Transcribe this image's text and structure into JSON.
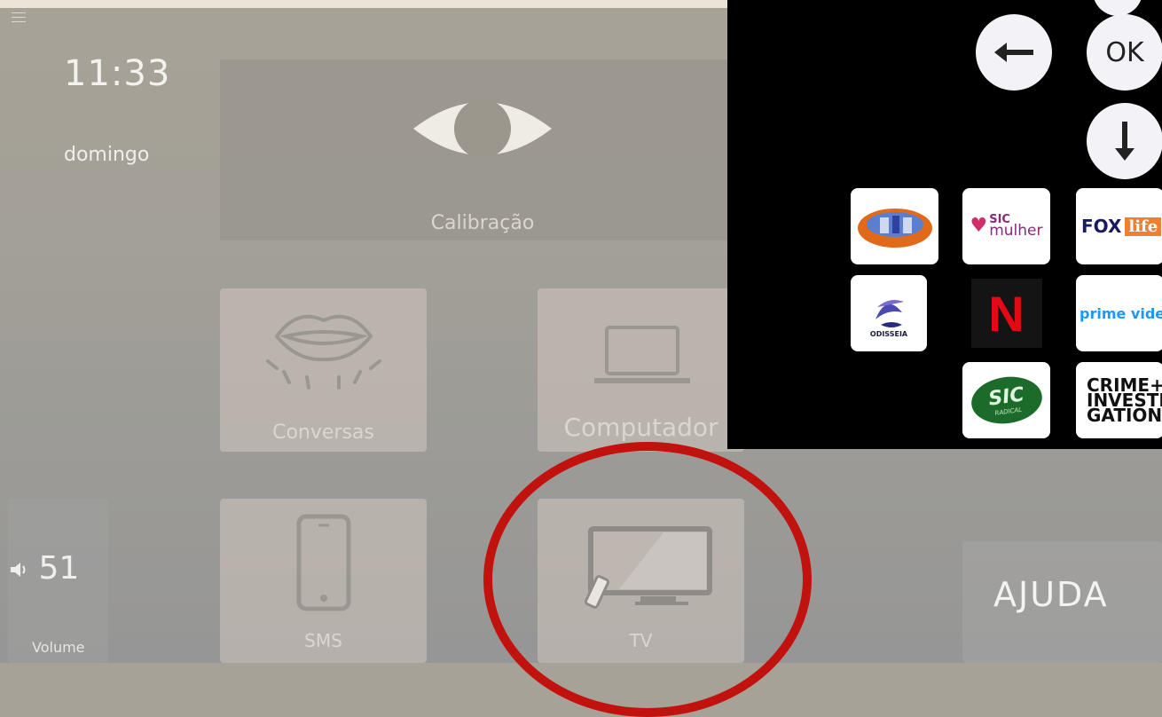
{
  "header": {
    "time": "11:33",
    "day": "domingo"
  },
  "tiles": {
    "calibration": "Calibração",
    "conversations": "Conversas",
    "computer": "Computador",
    "sms": "SMS",
    "tv": "TV"
  },
  "volume": {
    "value": "51",
    "label": "Volume"
  },
  "help": {
    "label": "AJUDA"
  },
  "remote": {
    "ok_label": "OK",
    "channels": {
      "sic_mulher": [
        "SIC",
        "mulher"
      ],
      "fox_life": [
        "FOX",
        "life"
      ],
      "odisseia": "ODISSEIA",
      "netflix": "N",
      "prime_video": "prime video",
      "sic_radical": [
        "SIC",
        "RADICAL"
      ],
      "crime_investigation": [
        "CRIME+",
        "INVESTI",
        "GATION"
      ]
    }
  },
  "colors": {
    "highlight_circle": "#c1120d",
    "remote_bg": "#000000"
  },
  "icons": [
    "menu-icon",
    "eye-icon",
    "lips-icon",
    "laptop-icon",
    "phone-icon",
    "tv-icon",
    "speaker-icon",
    "arrow-left-icon",
    "arrow-down-icon"
  ]
}
